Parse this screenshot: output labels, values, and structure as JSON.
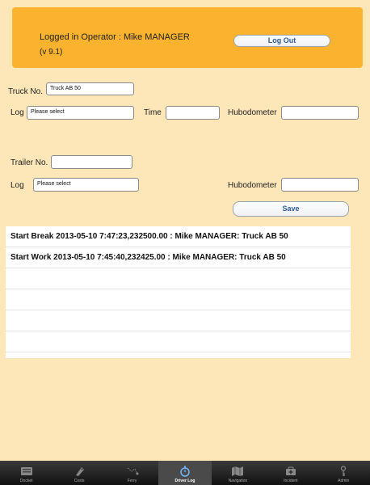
{
  "header": {
    "operator_text": "Logged in Operator : Mike MANAGER",
    "version": "(v 9.1)",
    "logout_label": "Log Out"
  },
  "truck": {
    "truck_no_label": "Truck No.",
    "truck_no_value": "Truck AB 50",
    "log_label": "Log",
    "log_value": "Please select",
    "time_label": "Time",
    "time_value": "",
    "hubo_label": "Hubodometer",
    "hubo_value": ""
  },
  "trailer": {
    "trailer_no_label": "Trailer No.",
    "trailer_no_value": "",
    "log_label": "Log",
    "log_value": "Please select",
    "hubo_label": "Hubodometer",
    "hubo_value": ""
  },
  "save_label": "Save",
  "log_entries": [
    "Start Break 2013-05-10 7:47:23,232500.00 : Mike MANAGER: Truck AB 50",
    "Start Work 2013-05-10 7:45:40,232425.00 : Mike MANAGER: Truck AB 50",
    "",
    "",
    "",
    ""
  ],
  "tabs": [
    {
      "label": "Docket",
      "icon": "docket-icon",
      "active": false
    },
    {
      "label": "Costs",
      "icon": "costs-icon",
      "active": false
    },
    {
      "label": "Ferry",
      "icon": "ferry-icon",
      "active": false
    },
    {
      "label": "Driver Log",
      "icon": "stopwatch-icon",
      "active": true
    },
    {
      "label": "Navigation",
      "icon": "map-icon",
      "active": false
    },
    {
      "label": "Incident",
      "icon": "incident-icon",
      "active": false
    },
    {
      "label": "Admin",
      "icon": "key-icon",
      "active": false
    }
  ]
}
